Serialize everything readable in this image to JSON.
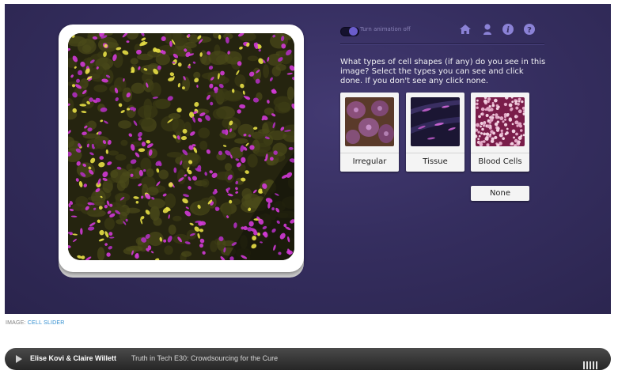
{
  "app": {
    "animation_toggle_label": "Turn animation off",
    "icons": [
      "home-icon",
      "profile-icon",
      "info-icon",
      "help-icon"
    ],
    "question": "What types of cell shapes (if any) do you see in this image? Select the types you can see and click done. If you don't see any click none.",
    "options": [
      {
        "label": "Irregular"
      },
      {
        "label": "Tissue"
      },
      {
        "label": "Blood Cells"
      }
    ],
    "none_label": "None"
  },
  "caption": {
    "prefix": "IMAGE:",
    "link": "CELL SLIDER"
  },
  "player": {
    "hosts": "Elise Kovi & Claire Willett",
    "episode": "Truth in Tech E30: Crowdsourcing for the Cure"
  },
  "colors": {
    "panel_bg": "#352e5f",
    "accent": "#6a5ccc",
    "caption_link": "#2e8ccf"
  }
}
